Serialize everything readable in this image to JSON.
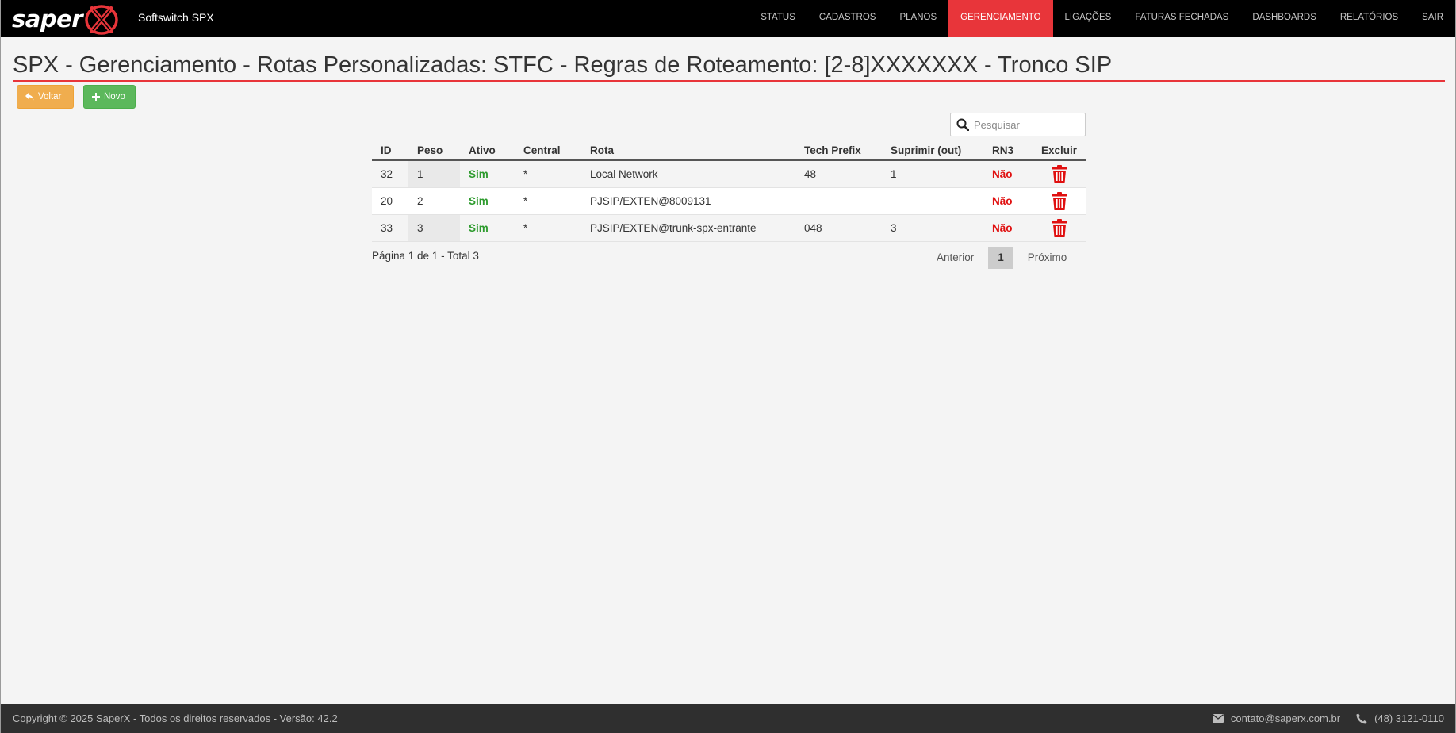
{
  "brand": {
    "logo_text": "saper",
    "product_name": "Softswitch SPX"
  },
  "nav": {
    "items": [
      {
        "label": "STATUS"
      },
      {
        "label": "CADASTROS"
      },
      {
        "label": "PLANOS"
      },
      {
        "label": "GERENCIAMENTO"
      },
      {
        "label": "LIGAÇÕES"
      },
      {
        "label": "FATURAS FECHADAS"
      },
      {
        "label": "DASHBOARDS"
      },
      {
        "label": "RELATÓRIOS"
      },
      {
        "label": "SAIR"
      }
    ],
    "active": "GERENCIAMENTO",
    "accent_color": "#e8353a"
  },
  "page": {
    "title": "SPX - Gerenciamento - Rotas Personalizadas: STFC - Regras de Roteamento: [2-8]XXXXXXX - Tronco SIP",
    "back_label": "Voltar",
    "new_label": "Novo"
  },
  "search": {
    "placeholder": "Pesquisar",
    "value": ""
  },
  "table": {
    "headers": {
      "id": "ID",
      "peso": "Peso",
      "ativo": "Ativo",
      "central": "Central",
      "rota": "Rota",
      "tech_prefix": "Tech Prefix",
      "suprimir": "Suprimir (out)",
      "rn3": "RN3",
      "excluir": "Excluir"
    },
    "rows": [
      {
        "id": "32",
        "peso": "1",
        "ativo": "Sim",
        "central": "*",
        "rota": "Local Network",
        "tech_prefix": "48",
        "suprimir": "1",
        "rn3": "Não"
      },
      {
        "id": "20",
        "peso": "2",
        "ativo": "Sim",
        "central": "*",
        "rota": "PJSIP/EXTEN@8009131",
        "tech_prefix": "",
        "suprimir": "",
        "rn3": "Não"
      },
      {
        "id": "33",
        "peso": "3",
        "ativo": "Sim",
        "central": "*",
        "rota": "PJSIP/EXTEN@trunk-spx-entrante",
        "tech_prefix": "048",
        "suprimir": "3",
        "rn3": "Não"
      }
    ]
  },
  "pagination": {
    "info": "Página 1 de 1 - Total 3",
    "prev": "Anterior",
    "current": "1",
    "next": "Próximo"
  },
  "footer": {
    "copyright": "Copyright © 2025 SaperX - Todos os direitos reservados - Versão: 42.2",
    "email": "contato@saperx.com.br",
    "phone": "(48) 3121-0110"
  }
}
